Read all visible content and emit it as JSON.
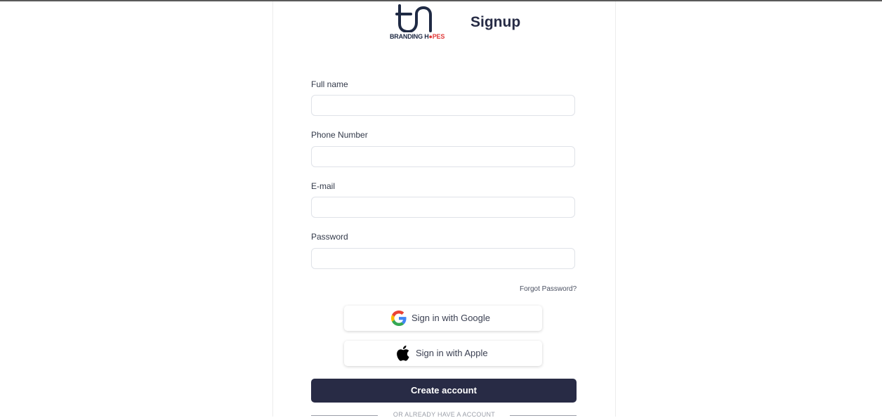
{
  "header": {
    "logo_text_main": "BRANDING H",
    "logo_text_accent": "PES",
    "title": "Signup"
  },
  "form": {
    "fields": [
      {
        "label": "Full name",
        "value": "",
        "placeholder": ""
      },
      {
        "label": "Phone Number",
        "value": "",
        "placeholder": ""
      },
      {
        "label": "E-mail",
        "value": "",
        "placeholder": ""
      },
      {
        "label": "Password",
        "value": "",
        "placeholder": ""
      }
    ],
    "forgot_password": "Forgot Password?",
    "google_button": "Sign in with Google",
    "apple_button": "Sign in with Apple",
    "create_button": "Create account",
    "divider_text": "OR ALREADY HAVE A ACCOUNT"
  },
  "colors": {
    "primary": "#282b45",
    "brand_accent": "#e03a3a",
    "google_blue": "#4285F4",
    "google_red": "#EA4335",
    "google_yellow": "#FBBC05",
    "google_green": "#34A853"
  },
  "icons": {
    "logo": "branding-hopes-logo",
    "google": "google-g-icon",
    "apple": "apple-icon"
  }
}
